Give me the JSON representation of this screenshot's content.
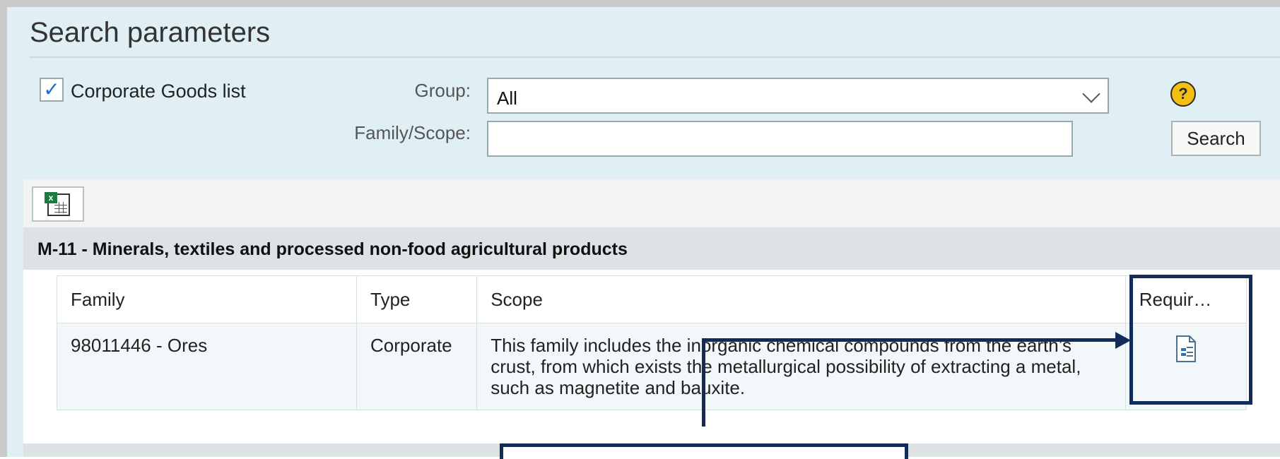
{
  "search_parameters": {
    "title": "Search parameters",
    "corporate_goods_checkbox": {
      "label": "Corporate Goods list",
      "checked": true
    },
    "group": {
      "label": "Group:",
      "value": "All"
    },
    "family_scope": {
      "label": "Family/Scope:",
      "value": ""
    },
    "search_label": "Search",
    "help_icon": "help-icon"
  },
  "results": {
    "export_icon": "export-excel-icon",
    "group_header": "M-11 - Minerals, textiles and processed non-food agricultural products",
    "columns": [
      "Family",
      "Type",
      "Scope",
      "Requir…"
    ],
    "rows": [
      {
        "family": "98011446 - Ores",
        "type": "Corporate",
        "scope": "This family includes the inorganic chemical compounds from the earth’s crust, from which exists the metallurgical possibility of extracting a metal, such as magnetite and bauxite.",
        "requirements_icon": "document-icon"
      }
    ]
  },
  "colors": {
    "panel_bg": "#dfeff3",
    "callout": "#122b58",
    "checkbox_check": "#1b6cc6",
    "help_icon": "#f3c012"
  }
}
